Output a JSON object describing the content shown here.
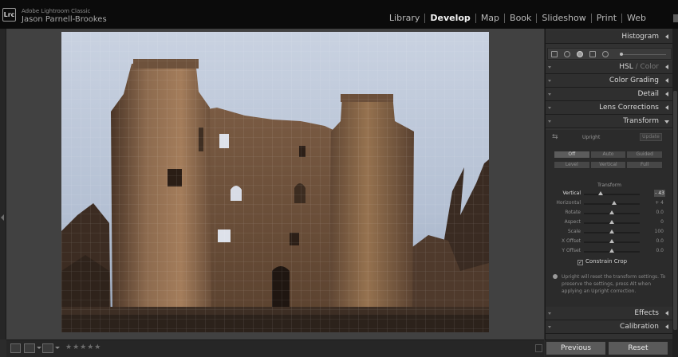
{
  "app": {
    "logo": "Lrc",
    "product": "Adobe Lightroom Classic",
    "user": "Jason Parnell-Brookes"
  },
  "modules": [
    {
      "label": "Library",
      "active": false
    },
    {
      "label": "Develop",
      "active": true
    },
    {
      "label": "Map",
      "active": false
    },
    {
      "label": "Book",
      "active": false
    },
    {
      "label": "Slideshow",
      "active": false
    },
    {
      "label": "Print",
      "active": false
    },
    {
      "label": "Web",
      "active": false
    }
  ],
  "panels": {
    "histogram": "Histogram",
    "hsl": "HSL",
    "hsl_sep": " / ",
    "color": "Color",
    "color_grading": "Color Grading",
    "detail": "Detail",
    "lens_corrections": "Lens Corrections",
    "transform": "Transform",
    "effects": "Effects",
    "calibration": "Calibration"
  },
  "transform": {
    "upright_label": "Upright",
    "update_button": "Update",
    "upright_row1": [
      "Off",
      "Auto",
      "Guided"
    ],
    "upright_row2": [
      "Level",
      "Vertical",
      "Full"
    ],
    "heading": "Transform",
    "sliders": [
      {
        "label": "Vertical",
        "value": "- 43"
      },
      {
        "label": "Horizontal",
        "value": "+ 4"
      },
      {
        "label": "Rotate",
        "value": "0.0"
      },
      {
        "label": "Aspect",
        "value": "0"
      },
      {
        "label": "Scale",
        "value": "100"
      },
      {
        "label": "X Offset",
        "value": "0.0"
      },
      {
        "label": "Y Offset",
        "value": "0.0"
      }
    ],
    "slider_levels": [
      0.3,
      0.54,
      0.5,
      0.5,
      0.5,
      0.5,
      0.5
    ],
    "constrain_crop": "Constrain Crop",
    "constrain_checked": true,
    "info_text": "Upright will reset the transform settings. To preserve the settings, press Alt when applying an Upright correction."
  },
  "footer": {
    "previous": "Previous",
    "reset": "Reset"
  },
  "toolbar": {
    "rating": "★★★★★"
  },
  "colors": {
    "topbar": "#0b0b0b",
    "workspace": "#414141",
    "panel": "#323232",
    "button": "#5a5a5a"
  }
}
